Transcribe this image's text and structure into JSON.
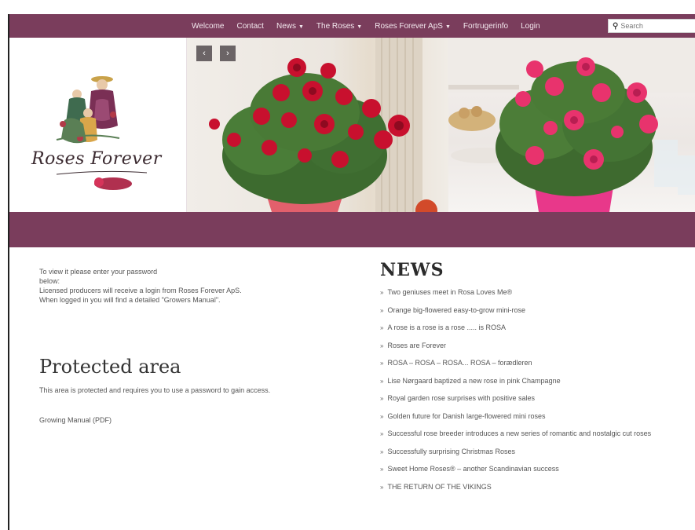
{
  "nav": {
    "items": [
      {
        "label": "Welcome",
        "dropdown": false
      },
      {
        "label": "Contact",
        "dropdown": false
      },
      {
        "label": "News",
        "dropdown": true
      },
      {
        "label": "The Roses",
        "dropdown": true
      },
      {
        "label": "Roses Forever ApS",
        "dropdown": true
      },
      {
        "label": "Fortrugerinfo",
        "dropdown": false
      },
      {
        "label": "Login",
        "dropdown": false
      }
    ],
    "search_placeholder": "Search"
  },
  "logo": {
    "text": "Roses Forever"
  },
  "slider": {
    "prev": "‹",
    "next": "›"
  },
  "intro": {
    "line1": "To view it please enter your password",
    "line2": "below:",
    "line3": "Licensed producers will receive a login from Roses Forever ApS.",
    "line4": "When logged in you will find a detailed \"Growers Manual\"."
  },
  "protected": {
    "title": "Protected area",
    "description": "This area is protected and requires you to use a password to gain access.",
    "manual_link": "Growing Manual (PDF)"
  },
  "news": {
    "title": "NEWS",
    "items": [
      "Two geniuses meet in Rosa Loves Me®",
      "Orange big-flowered easy-to-grow mini-rose",
      "A rose is a rose is a rose ..... is ROSA",
      "Roses are Forever",
      "ROSA – ROSA – ROSA... ROSA – forædleren",
      "Lise Nørgaard baptized a new rose in pink Champagne",
      "Royal garden rose surprises with positive sales",
      "Golden future for Danish large-flowered mini roses",
      "Successful rose breeder introduces a new series of romantic and nostalgic cut roses",
      "Successfully surprising Christmas Roses",
      "Sweet Home Roses® – another Scandinavian success",
      "THE RETURN OF THE VIKINGS"
    ]
  },
  "colors": {
    "brand": "#7a3d5c",
    "rose_red": "#c8102e",
    "rose_pink": "#e8336d"
  }
}
